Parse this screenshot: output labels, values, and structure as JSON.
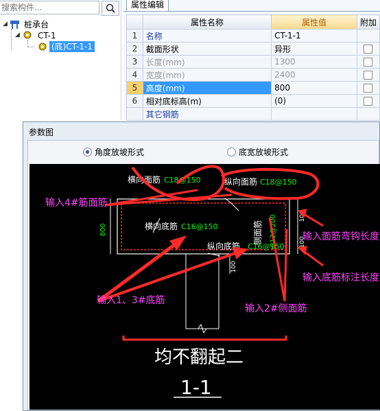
{
  "left_panel": {
    "search_placeholder": "搜索构件...",
    "tree": {
      "root": "桩承台",
      "child": "CT-1",
      "leaf": "(底)CT-1-1"
    }
  },
  "property_panel": {
    "tab": "属性编辑",
    "headers": {
      "name": "属性名称",
      "value": "属性值",
      "extra": "附加"
    },
    "rows": [
      {
        "idx": "1",
        "name": "名称",
        "value": "CT-1-1"
      },
      {
        "idx": "2",
        "name": "截面形状",
        "value": "异形"
      },
      {
        "idx": "3",
        "name": "长度(mm)",
        "value": "1300"
      },
      {
        "idx": "4",
        "name": "宽度(mm)",
        "value": "2400"
      },
      {
        "idx": "5",
        "name": "高度(mm)",
        "value": "800"
      },
      {
        "idx": "6",
        "name": "相对底标高(m)",
        "value": "(0)"
      },
      {
        "idx": "",
        "name": "其它钢筋",
        "value": ""
      }
    ]
  },
  "dialog": {
    "title": "参数图",
    "radio_angle": "角度放坡形式",
    "radio_width": "底宽放坡形式"
  },
  "drawing": {
    "top_horiz_label": "横向面筋",
    "top_horiz_value": "C18@150",
    "top_long_label": "纵向面筋",
    "top_long_value": "C18@150",
    "bot_horiz_label": "横向底筋",
    "bot_horiz_value": "C16@150",
    "bot_long_label": "纵向底筋",
    "bot_long_value": "C16@150",
    "side_label": "侧面筋",
    "side_value": "C12@200",
    "height_dim": "800",
    "dim_top": "100",
    "dim_mid": "100",
    "dim_bot": "100",
    "big_caption": "均不翻起二",
    "section": "1-1"
  },
  "annotations": {
    "input_top": "输入4#筋面筋",
    "input_bottom": "输入1、3#底筋",
    "input_side": "输入2#侧面筋",
    "input_hook": "输入面筋弯钩长度",
    "input_bottom_len": "输入底筋标注长度"
  },
  "colors": {
    "selection": "#3399ff",
    "header_highlight": "#f7d98c",
    "annotation_text": "#ff44ff",
    "red_marks": "#ff2a2a",
    "rebar_green": "#00ff00"
  }
}
